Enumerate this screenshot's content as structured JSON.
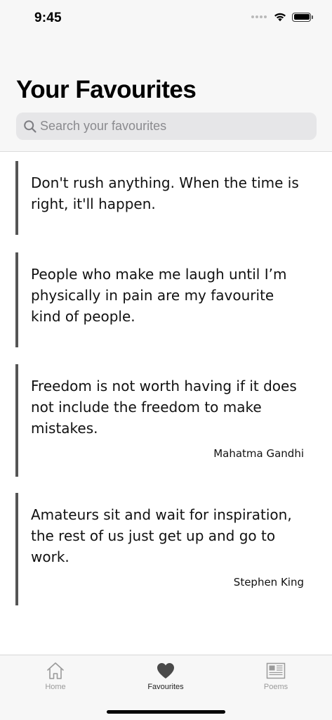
{
  "status_bar": {
    "time": "9:45",
    "icons": [
      "signal-dots-icon",
      "wifi-icon",
      "battery-icon"
    ]
  },
  "header": {
    "title": "Your Favourites"
  },
  "search": {
    "placeholder": "Search your favourites",
    "value": "",
    "icon": "magnifier-icon"
  },
  "quotes": [
    {
      "text": "Don't rush anything. When the time is right, it'll happen.",
      "author": ""
    },
    {
      "text": "People who make me laugh until I’m physically in pain are my favourite kind of people.",
      "author": ""
    },
    {
      "text": "Freedom is not worth having if it does not include the freedom to make mistakes.",
      "author": "Mahatma Gandhi"
    },
    {
      "text": "Amateurs sit and wait for inspiration, the rest of us just get up and go to work.",
      "author": "Stephen King"
    }
  ],
  "tab_bar": {
    "selected": "Favourites",
    "tabs": [
      {
        "label": "Home",
        "icon": "house-icon",
        "active": false
      },
      {
        "label": "Favourites",
        "icon": "heart-icon",
        "active": true
      },
      {
        "label": "Poems",
        "icon": "newspaper-icon",
        "active": false
      }
    ]
  },
  "colors": {
    "quote_border": "#555555",
    "header_background": "#f7f7f7",
    "search_background": "#e6e6e8",
    "tab_active": "#222222",
    "tab_inactive": "#9a9a9a"
  }
}
